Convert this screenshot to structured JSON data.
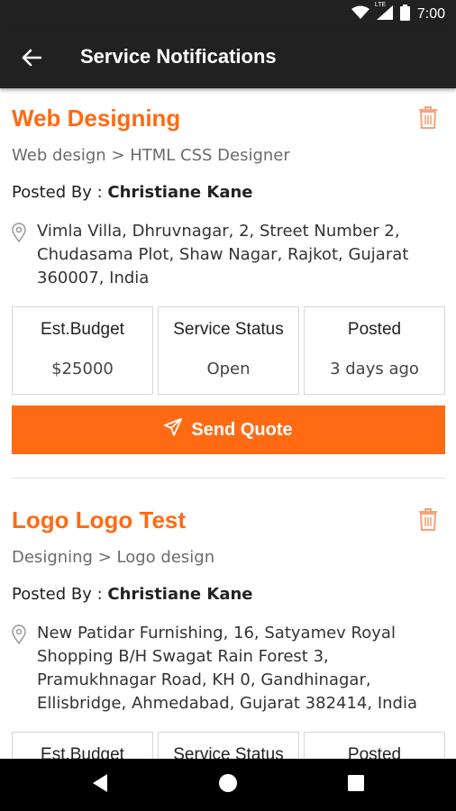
{
  "status_bar": {
    "time": "7:00",
    "network_label": "LTE"
  },
  "app_bar": {
    "title": "Service Notifications"
  },
  "notifications": [
    {
      "title": "Web Designing",
      "category": "Web design > HTML CSS Designer",
      "posted_by_label": "Posted By : ",
      "posted_by_name": "Christiane Kane",
      "address": "Vimla Villa, Dhruvnagar, 2, Street Number 2, Chudasama Plot, Shaw Nagar, Rajkot, Gujarat 360007, India",
      "budget_label": "Est.Budget",
      "budget_value": "$25000",
      "status_label": "Service Status",
      "status_value": "Open",
      "posted_label": "Posted",
      "posted_value": "3 days ago",
      "action_label": "Send Quote"
    },
    {
      "title": "Logo Logo Test",
      "category": "Designing > Logo design",
      "posted_by_label": "Posted By : ",
      "posted_by_name": "Christiane Kane",
      "address": "New Patidar Furnishing, 16, Satyamev Royal Shopping B/H Swagat Rain Forest 3, Pramukhnagar Road, KH 0, Gandhinagar, Ellisbridge, Ahmedabad, Gujarat 382414, India",
      "budget_label": "Est.Budget",
      "status_label": "Service Status",
      "posted_label": "Posted"
    }
  ],
  "colors": {
    "accent": "#ff6a13",
    "app_bar": "#212121",
    "nav_bar": "#000000"
  },
  "icons": {
    "back": "arrow-back-icon",
    "delete": "trash-icon",
    "location": "location-pin-icon",
    "send": "send-icon",
    "nav_back": "triangle-back-icon",
    "nav_home": "circle-home-icon",
    "nav_recents": "square-recents-icon"
  }
}
